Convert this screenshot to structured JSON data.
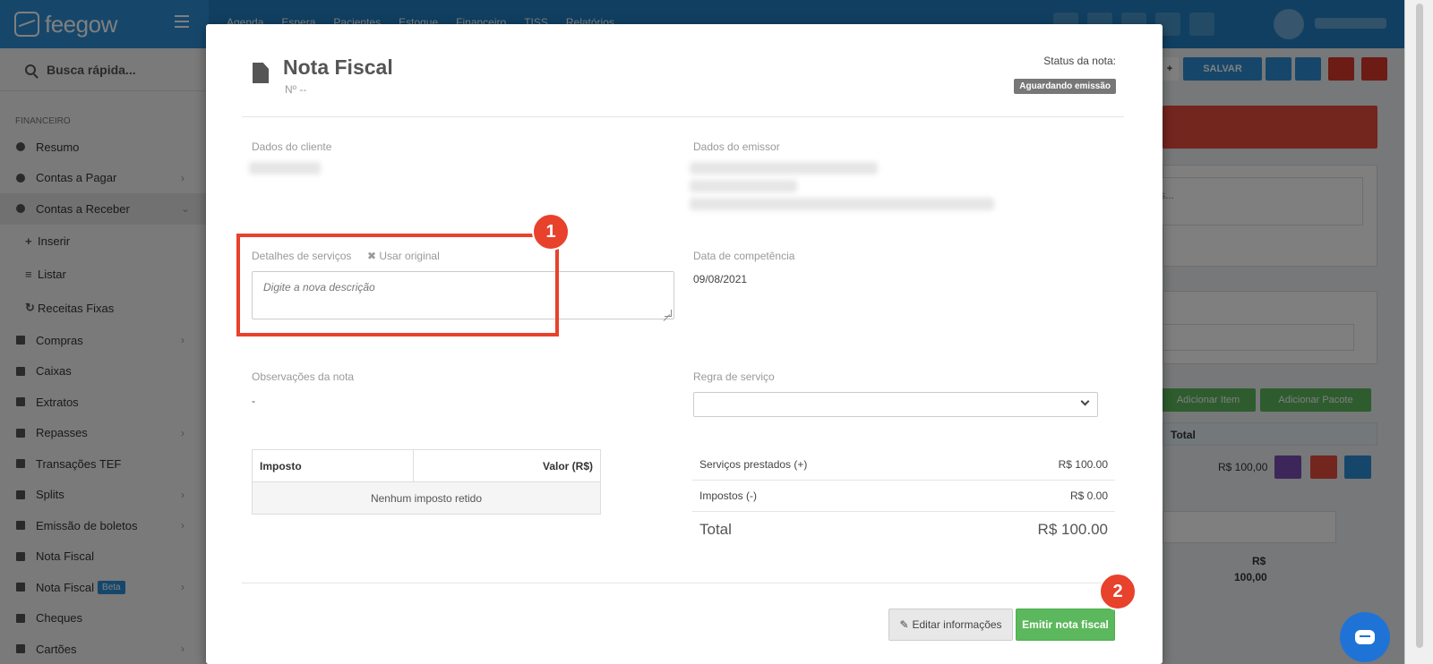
{
  "app": {
    "logo": "feegow",
    "top_nav": [
      "Agenda",
      "Espera",
      "Pacientes",
      "Estoque",
      "Financeiro",
      "TISS",
      "Relatórios"
    ],
    "brand_color": "#217fc3"
  },
  "sidebar": {
    "search_label": "Busca rápida...",
    "section": "FINANCEIRO",
    "items": [
      {
        "label": "Resumo",
        "icon": "pie-chart-icon"
      },
      {
        "label": "Contas a Pagar",
        "icon": "minus-circle-icon"
      },
      {
        "label": "Contas a Receber",
        "icon": "plus-circle-icon"
      },
      {
        "label": "Inserir",
        "icon": "plus-icon"
      },
      {
        "label": "Listar",
        "icon": "list-icon"
      },
      {
        "label": "Receitas Fixas",
        "icon": "refresh-icon"
      },
      {
        "label": "Compras",
        "icon": "cart-icon"
      },
      {
        "label": "Caixas",
        "icon": "inbox-icon"
      },
      {
        "label": "Extratos",
        "icon": "list-icon"
      },
      {
        "label": "Repasses",
        "icon": "sitemap-icon"
      },
      {
        "label": "Transações TEF",
        "icon": "credit-card-icon"
      },
      {
        "label": "Splits",
        "icon": "split-icon"
      },
      {
        "label": "Emissão de boletos",
        "icon": "barcode-icon"
      },
      {
        "label": "Nota Fiscal",
        "icon": "file-icon"
      },
      {
        "label": "Nota Fiscal",
        "icon": "file-icon",
        "badge": "Beta"
      },
      {
        "label": "Cheques",
        "icon": "file-icon"
      },
      {
        "label": "Cartões",
        "icon": "credit-card-icon"
      }
    ]
  },
  "background": {
    "save_label": "SALVAR",
    "add_item_label": "Adicionar Item",
    "add_package_label": "Adicionar Pacote",
    "total_header": "Total",
    "row_value": "R$ 100,00",
    "footer_currency": "R$",
    "footer_value": "100,00",
    "textarea_fragment": "s..."
  },
  "modal": {
    "title": "Nota Fiscal",
    "number": "Nº --",
    "status_label": "Status da nota:",
    "status_badge": "Aguardando emissão",
    "client_label": "Dados do cliente",
    "issuer_label": "Dados do emissor",
    "services_label": "Detalhes de serviços",
    "use_original": "Usar original",
    "services_placeholder": "Digite a nova descrição",
    "competence_label": "Data de competência",
    "competence_value": "09/08/2021",
    "notes_label": "Observações da nota",
    "notes_value": "-",
    "service_rule_label": "Regra de serviço",
    "tax_table": {
      "headers": [
        "Imposto",
        "Valor (R$)"
      ],
      "empty": "Nenhum imposto retido"
    },
    "summary": [
      {
        "label": "Serviços prestados (+)",
        "value": "R$ 100.00"
      },
      {
        "label": "Impostos (-)",
        "value": "R$ 0.00"
      }
    ],
    "total_label": "Total",
    "total_value": "R$ 100.00",
    "edit_button": "Editar informações",
    "emit_button": "Emitir nota fiscal"
  },
  "annotations": {
    "badge1": "1",
    "badge2": "2",
    "color": "#e8412c"
  }
}
